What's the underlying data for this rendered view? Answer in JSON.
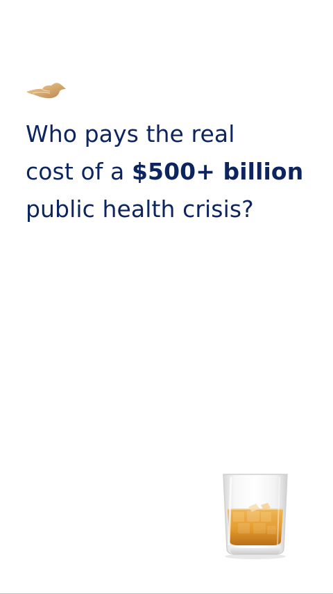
{
  "headline": {
    "line1": "Who pays the real",
    "line2_prefix": "cost of a ",
    "line2_emphasis": "$500+ billion",
    "line3": "public health crisis?"
  },
  "icons": {
    "brand": "dove-icon",
    "illustration": "whiskey-glass-icon"
  },
  "colors": {
    "headline": "#0c2460",
    "brand_gold": "#d9ad73",
    "liquid_amber": "#e6a23c",
    "divider": "#bdbdbd"
  }
}
